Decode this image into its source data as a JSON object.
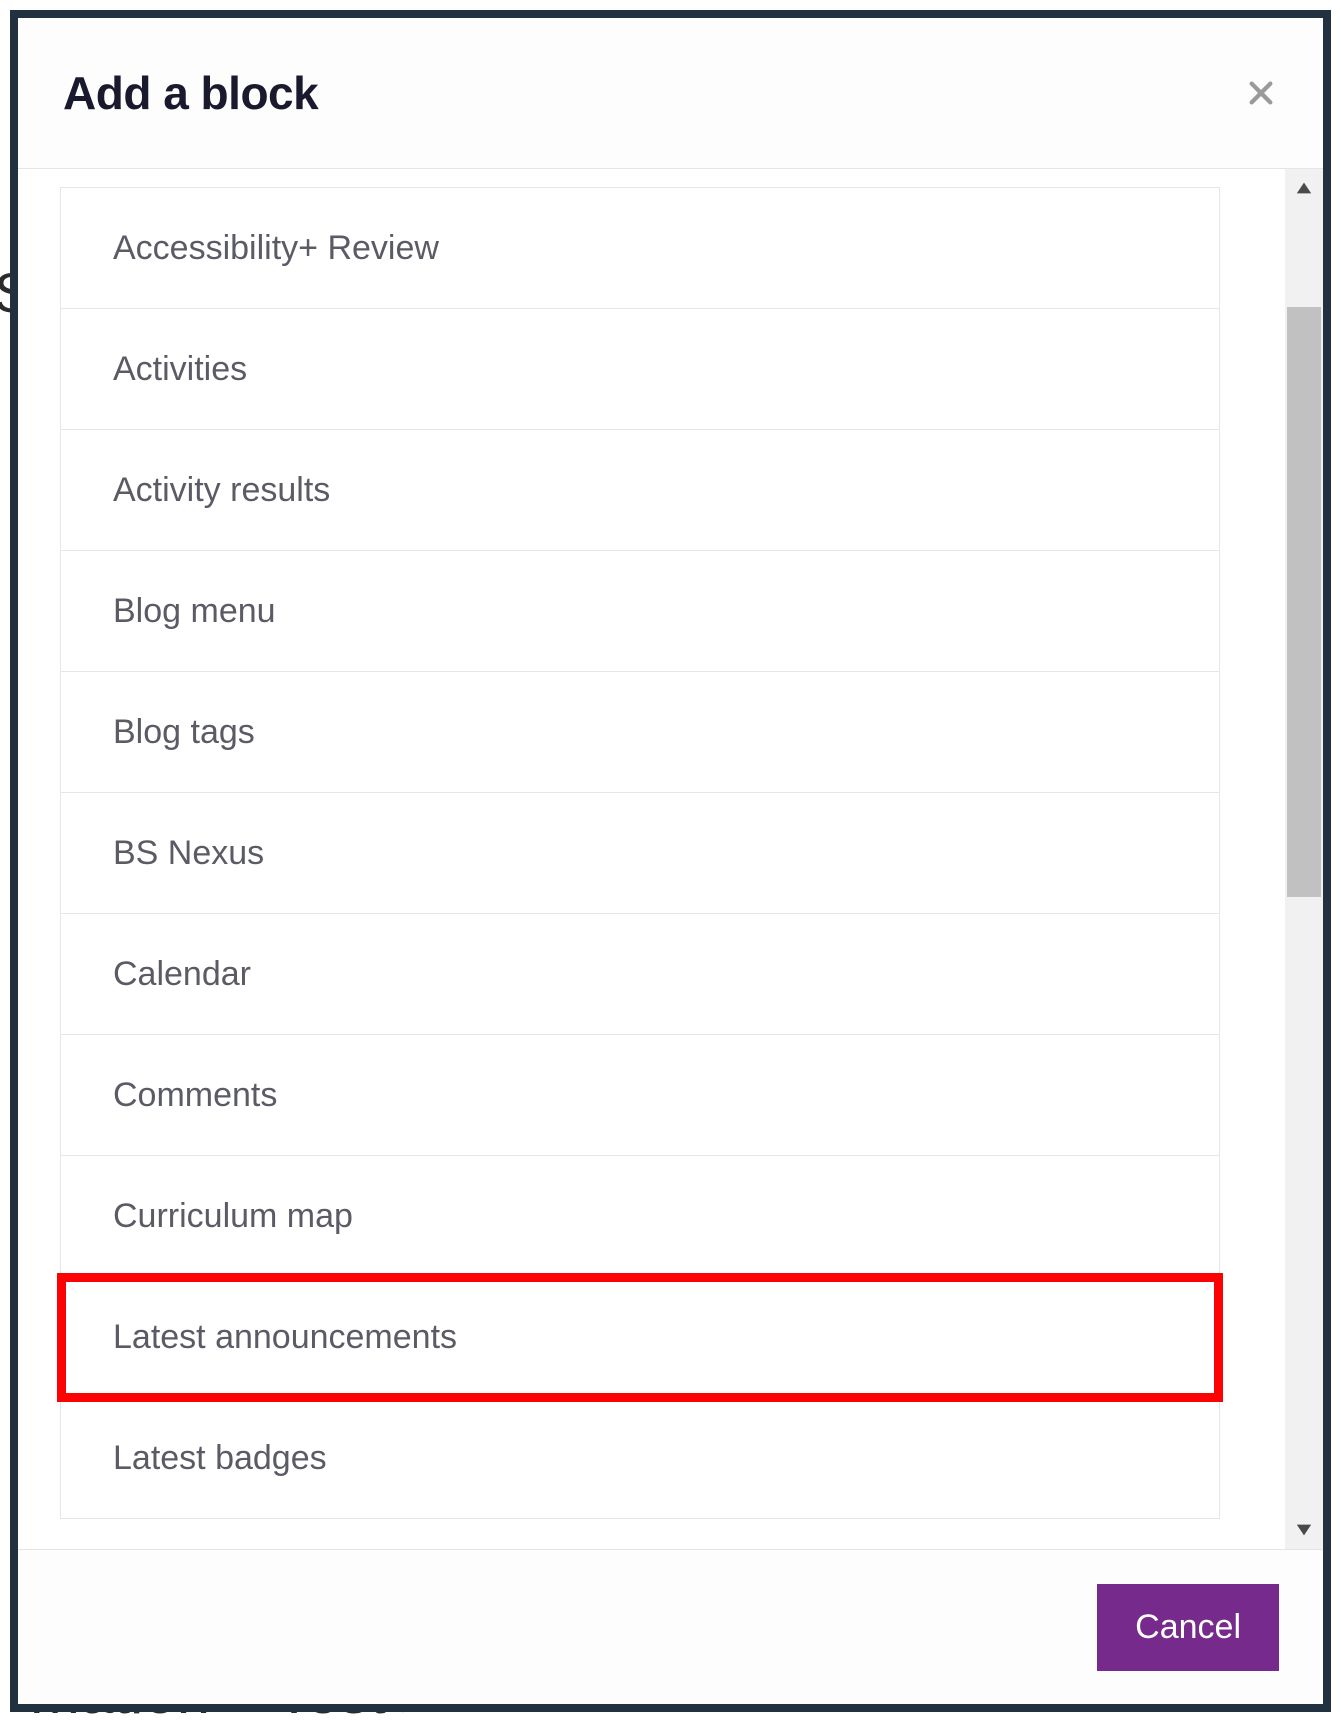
{
  "modal": {
    "title": "Add a block",
    "cancel_label": "Cancel"
  },
  "blocks": [
    {
      "label": "Accessibility+ Review",
      "highlighted": false
    },
    {
      "label": "Activities",
      "highlighted": false
    },
    {
      "label": "Activity results",
      "highlighted": false
    },
    {
      "label": "Blog menu",
      "highlighted": false
    },
    {
      "label": "Blog tags",
      "highlighted": false
    },
    {
      "label": "BS Nexus",
      "highlighted": false
    },
    {
      "label": "Calendar",
      "highlighted": false
    },
    {
      "label": "Comments",
      "highlighted": false
    },
    {
      "label": "Curriculum map",
      "highlighted": false
    },
    {
      "label": "Latest announcements",
      "highlighted": true
    },
    {
      "label": "Latest badges",
      "highlighted": false
    }
  ],
  "bg_fragments": {
    "left_letter": "S",
    "bottom_text": "ˈmation – Test ▸"
  }
}
